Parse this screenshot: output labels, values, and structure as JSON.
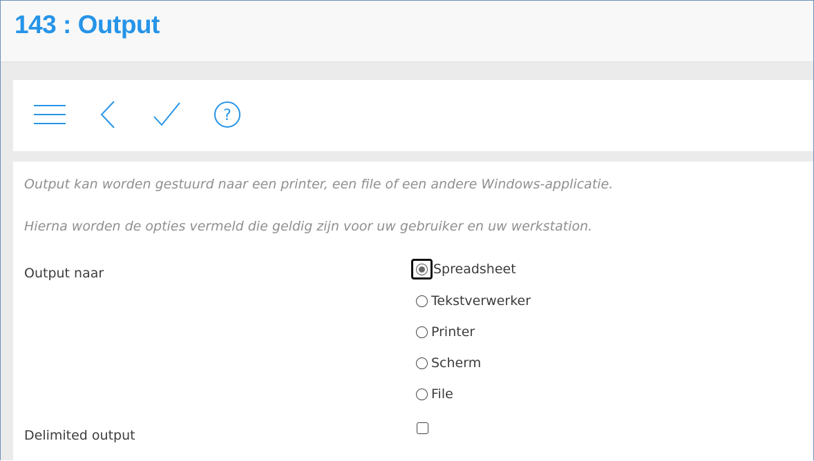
{
  "header": {
    "title": "143 : Output"
  },
  "toolbar": {
    "icons": [
      "menu-icon",
      "back-icon",
      "confirm-icon",
      "help-icon"
    ],
    "accent_color": "#2694e8"
  },
  "form": {
    "info_lines": [
      "Output kan worden gestuurd naar een printer, een file of een andere Windows-applicatie.",
      "Hierna worden de opties vermeld die geldig zijn voor uw gebruiker en uw werkstation."
    ],
    "output_label": "Output naar",
    "output_options": [
      "Spreadsheet",
      "Tekstverwerker",
      "Printer",
      "Scherm",
      "File"
    ],
    "output_selected": "Spreadsheet",
    "delimited_label": "Delimited output",
    "delimited_checked": false
  }
}
